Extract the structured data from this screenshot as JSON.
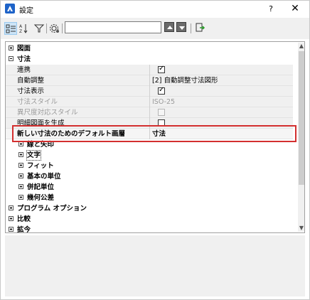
{
  "window": {
    "title": "設定",
    "help": "?",
    "close": "✕"
  },
  "search": {
    "value": "",
    "placeholder": ""
  },
  "rows": {
    "zumen": "図面",
    "sunpo": "寸法",
    "renkei": {
      "label": "連携",
      "checked": true
    },
    "jidou": {
      "label": "自動調整",
      "value": "[2] 自動調整寸法図形"
    },
    "hyouji": {
      "label": "寸法表示",
      "checked": true
    },
    "style": {
      "label": "寸法スタイル",
      "value": "ISO-25"
    },
    "shakudo": {
      "label": "異尺度対応スタイル"
    },
    "meisai": {
      "label": "明細図面を生成"
    },
    "default_layer": {
      "label": "新しい寸法のためのデフォルト画層",
      "value": "寸法"
    },
    "sen": "線と矢印",
    "moji": "文字",
    "fit": "フィット",
    "kihon": "基本の単位",
    "heiki": "併記単位",
    "kika": "幾何公差",
    "program": "プログラム オプション",
    "hikaku": "比較",
    "hokan": "拡今"
  },
  "colors": {
    "accent": "#1e63c8",
    "highlight": "#d32f2f"
  }
}
